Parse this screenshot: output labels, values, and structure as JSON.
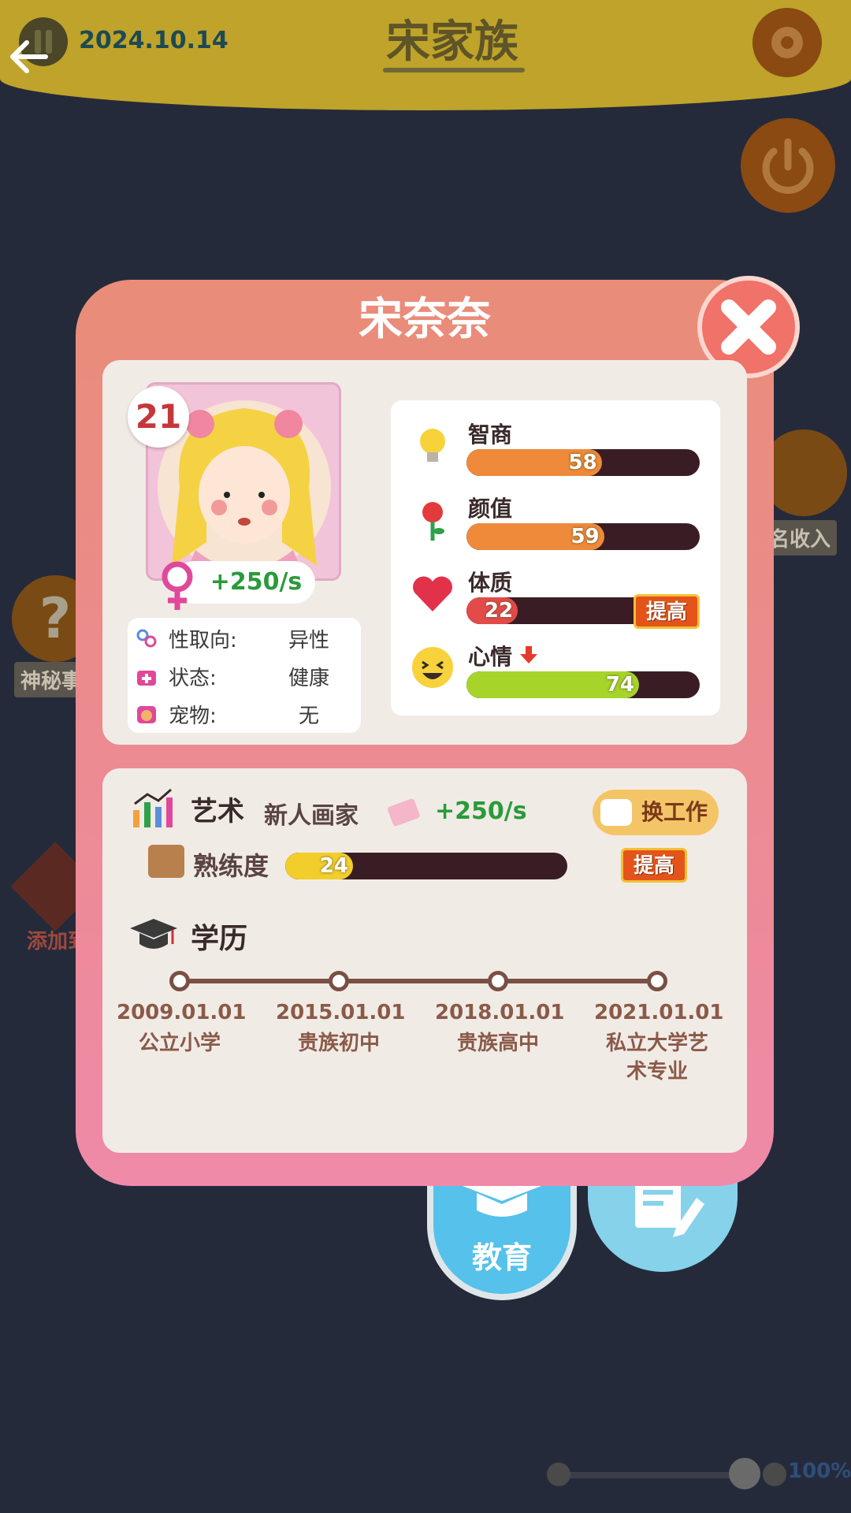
{
  "top_bar": {
    "date": "2024.10.14",
    "family_name": "宋家族"
  },
  "background": {
    "mystery_label": "神秘事",
    "income_label": "名收入",
    "add_label": "添加到",
    "zoom": "100%"
  },
  "modal": {
    "title": "宋奈奈",
    "age": "21",
    "income": "+250/s",
    "info": [
      {
        "label": "性取向:",
        "value": "异性"
      },
      {
        "label": "状态:",
        "value": "健康"
      },
      {
        "label": "宠物:",
        "value": "无"
      }
    ],
    "stats": [
      {
        "label": "智商",
        "value": 58,
        "color": "#ee8a3a",
        "icon": "lightbulb-icon"
      },
      {
        "label": "颜值",
        "value": 59,
        "color": "#ee8a3a",
        "icon": "rose-icon"
      },
      {
        "label": "体质",
        "value": 22,
        "color": "#e34a4a",
        "icon": "heart-icon",
        "button": "提高"
      },
      {
        "label": "心情",
        "value": 74,
        "color": "#a6d42a",
        "icon": "laughing-face-icon",
        "trend": "down"
      }
    ],
    "job": {
      "category": "艺术",
      "title": "新人画家",
      "income": "+250/s",
      "change_button": "换工作",
      "skill_label": "熟练度",
      "skill_value": 24,
      "improve_button": "提高"
    },
    "education": {
      "label": "学历",
      "timeline": [
        {
          "date": "2009.01.01",
          "school": "公立小学"
        },
        {
          "date": "2015.01.01",
          "school": "贵族初中"
        },
        {
          "date": "2018.01.01",
          "school": "贵族高中"
        },
        {
          "date": "2021.01.01",
          "school": "私立大学艺术专业"
        }
      ]
    }
  },
  "tabs": {
    "education_label": "教育"
  }
}
